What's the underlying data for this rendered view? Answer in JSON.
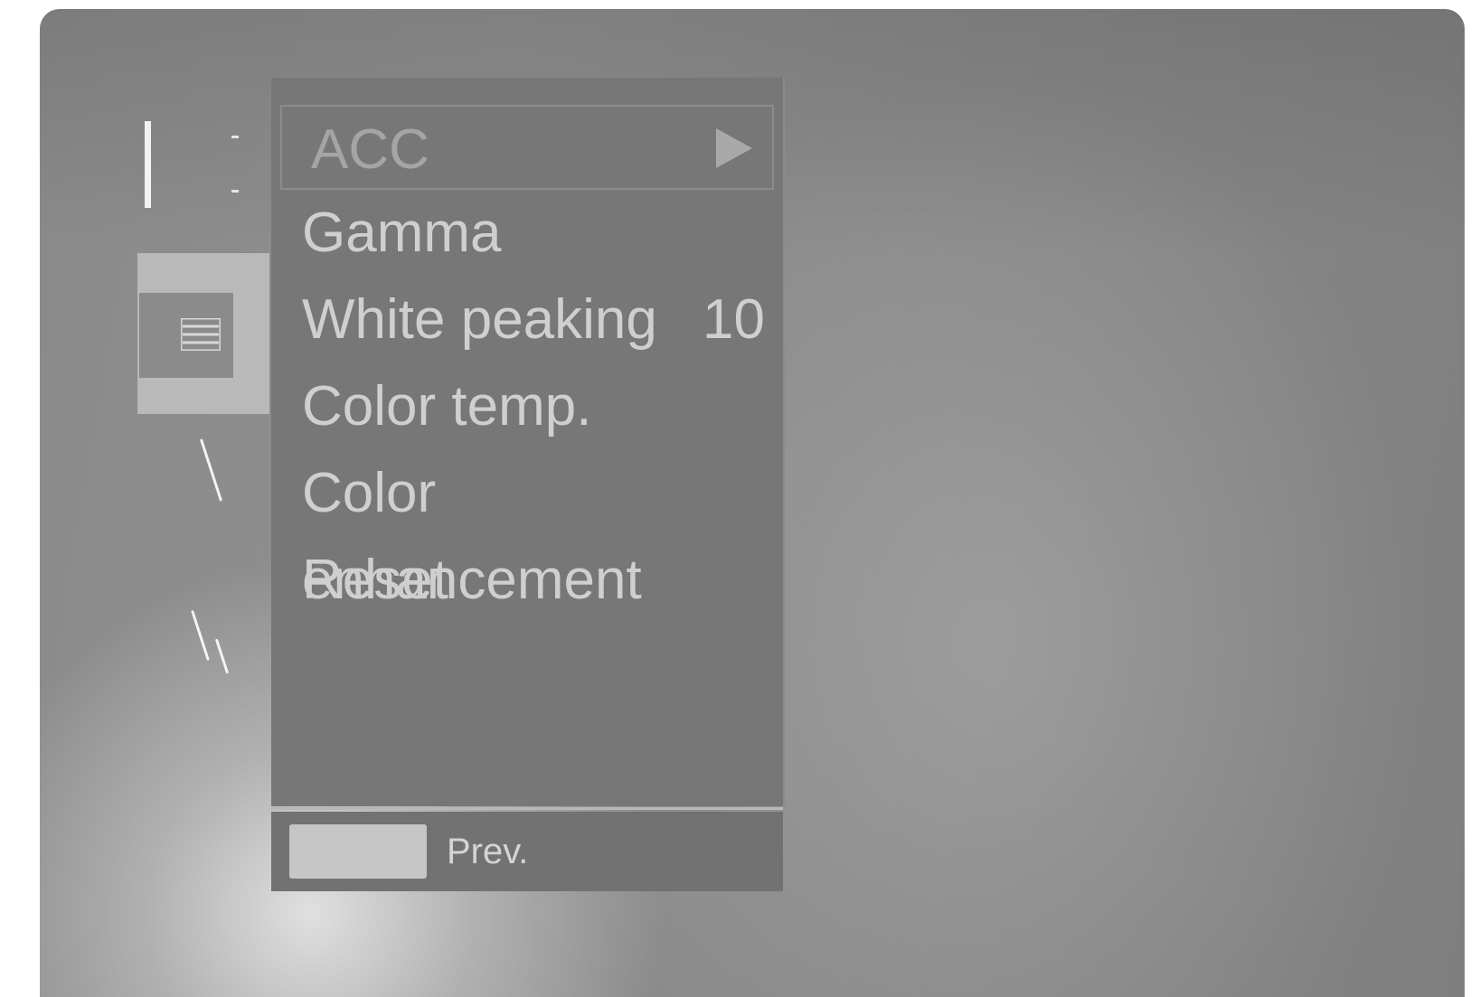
{
  "menu": {
    "items": [
      {
        "label": "ACC",
        "value": "",
        "selected": true
      },
      {
        "label": "Gamma",
        "value": ""
      },
      {
        "label": "White peaking",
        "value": "10"
      },
      {
        "label": "Color temp.",
        "value": ""
      },
      {
        "label": "Color enhancement",
        "value": ""
      },
      {
        "label": "Reset",
        "value": ""
      }
    ]
  },
  "footer": {
    "prev_label": "Prev."
  },
  "icons": {
    "selected_arrow": "arrow-right-icon",
    "category_tile": "menu-list-icon"
  },
  "colors": {
    "menu_background": "#777777",
    "text": "#cfcfcf",
    "selected_text": "#a5a5a5"
  }
}
